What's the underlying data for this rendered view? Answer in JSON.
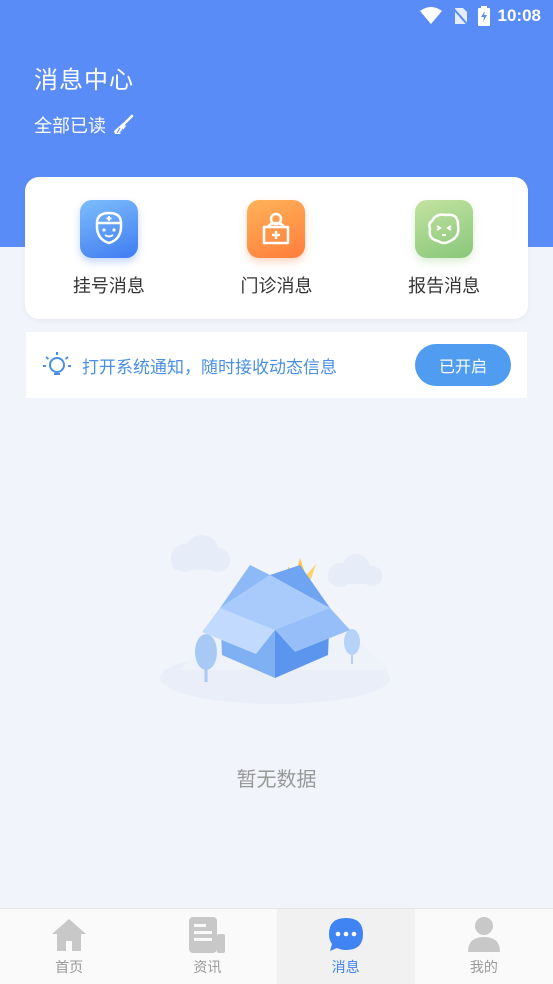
{
  "status_bar": {
    "time": "10:08",
    "icons": [
      "wifi-icon",
      "no-sim-icon",
      "battery-charging-icon"
    ]
  },
  "header": {
    "title": "消息中心",
    "mark_all_read": "全部已读",
    "mark_icon": "broom-icon"
  },
  "categories": [
    {
      "label": "挂号消息",
      "icon": "nurse-icon",
      "color": "#4f8ef5"
    },
    {
      "label": "门诊消息",
      "icon": "medical-kit-icon",
      "color": "#ff8a40"
    },
    {
      "label": "报告消息",
      "icon": "report-face-icon",
      "color": "#9acd86"
    }
  ],
  "notify": {
    "text": "打开系统通知，随时接收动态信息",
    "button": "已开启",
    "icon": "lightbulb-icon"
  },
  "empty": {
    "text": "暂无数据",
    "icon": "empty-box-icon"
  },
  "tabs": [
    {
      "label": "首页",
      "icon": "home-icon",
      "active": false
    },
    {
      "label": "资讯",
      "icon": "news-icon",
      "active": false
    },
    {
      "label": "消息",
      "icon": "chat-bubble-icon",
      "active": true
    },
    {
      "label": "我的",
      "icon": "user-icon",
      "active": false
    }
  ],
  "colors": {
    "primary": "#5a8cf7",
    "accent": "#3f84f2",
    "background": "#f1f4fa"
  }
}
